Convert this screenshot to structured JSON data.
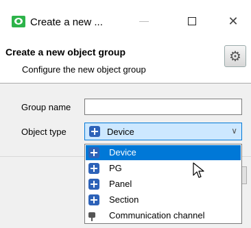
{
  "window": {
    "title": "Create a new ..."
  },
  "header": {
    "title": "Create a new object group",
    "subtitle": "Configure the new object group",
    "icon": "gear-icon"
  },
  "form": {
    "group_name_label": "Group name",
    "group_name_value": "",
    "object_type_label": "Object type",
    "object_type_selected": "Device"
  },
  "dropdown": {
    "options": [
      {
        "label": "Device",
        "icon": "puzzle-icon",
        "selected": true
      },
      {
        "label": "PG",
        "icon": "puzzle-icon"
      },
      {
        "label": "Panel",
        "icon": "puzzle-icon"
      },
      {
        "label": "Section",
        "icon": "puzzle-icon"
      },
      {
        "label": "Communication channel",
        "icon": "plug-icon"
      }
    ]
  },
  "colors": {
    "accent": "#0078d7",
    "app_icon": "#2db34a",
    "select_bg": "#cde8ff"
  }
}
